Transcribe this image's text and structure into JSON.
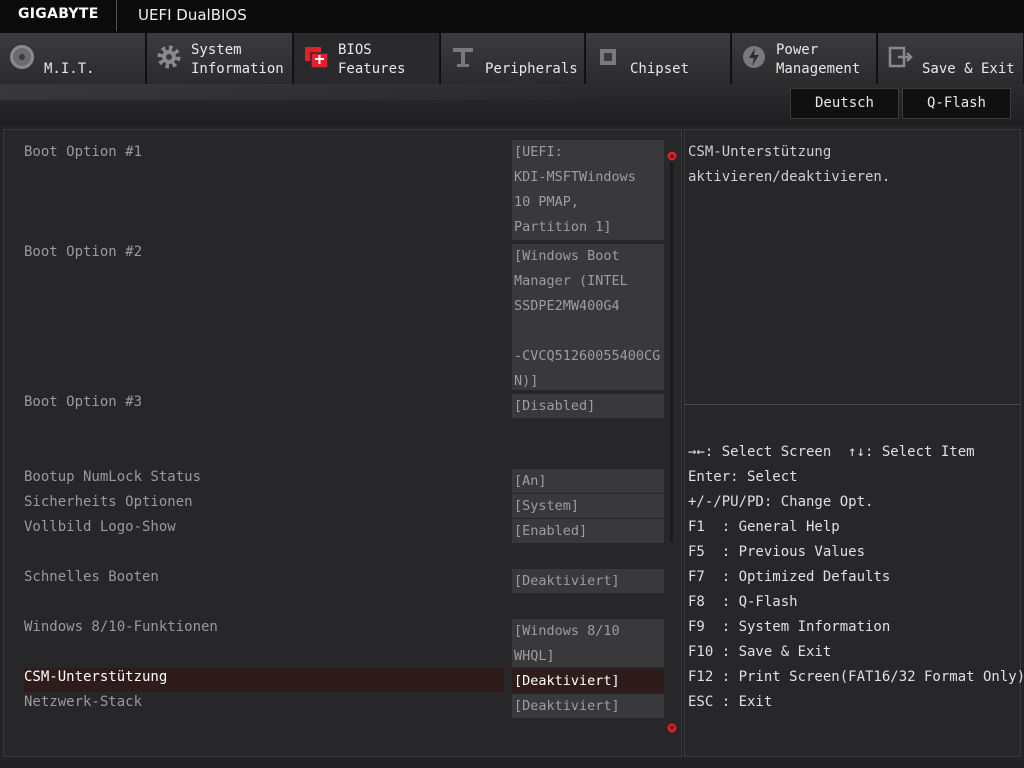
{
  "header": {
    "brand": "GIGABYTE",
    "title": "UEFI DualBIOS"
  },
  "tabs": [
    {
      "line1": "",
      "line2": "M.I.T.",
      "icon": "mit-icon"
    },
    {
      "line1": "System",
      "line2": "Information",
      "icon": "gear-icon"
    },
    {
      "line1": "BIOS",
      "line2": "Features",
      "icon": "bios-chip-icon",
      "active": true
    },
    {
      "line1": "",
      "line2": "Peripherals",
      "icon": "peripherals-icon"
    },
    {
      "line1": "",
      "line2": "Chipset",
      "icon": "chipset-icon"
    },
    {
      "line1": "Power",
      "line2": "Management",
      "icon": "power-icon"
    },
    {
      "line1": "",
      "line2": "Save & Exit",
      "icon": "exit-icon"
    }
  ],
  "toolbar": {
    "language": "Deutsch",
    "qflash": "Q-Flash"
  },
  "options": [
    {
      "label": "Boot Option #1",
      "value": [
        "[UEFI:",
        "KDI-MSFTWindows",
        "10 PMAP,",
        "Partition 1]"
      ]
    },
    {
      "label": "Boot Option #2",
      "value": [
        "[Windows Boot",
        "Manager (INTEL",
        "SSDPE2MW400G4",
        "",
        "-CVCQ51260055400CG",
        "N)]"
      ]
    },
    {
      "label": "Boot Option #3",
      "value": [
        "[Disabled]"
      ]
    },
    {
      "label": "Bootup NumLock Status",
      "value": [
        "[An]"
      ]
    },
    {
      "label": "Sicherheits Optionen",
      "value": [
        "[System]"
      ]
    },
    {
      "label": "Vollbild Logo-Show",
      "value": [
        "[Enabled]"
      ]
    },
    {
      "label": "Schnelles Booten",
      "value": [
        "[Deaktiviert]"
      ]
    },
    {
      "label": "Windows 8/10-Funktionen",
      "value": [
        "[Windows 8/10",
        "WHQL]"
      ]
    },
    {
      "label": "CSM-Unterstützung",
      "value": [
        "[Deaktiviert]"
      ],
      "selected": true
    },
    {
      "label": "Netzwerk-Stack",
      "value": [
        "[Deaktiviert]"
      ]
    }
  ],
  "help": {
    "description": [
      "CSM-Unterstützung",
      "aktivieren/deaktivieren."
    ],
    "keys": [
      "→←: Select Screen  ↑↓: Select Item",
      "Enter: Select",
      "+/-/PU/PD: Change Opt.",
      "F1  : General Help",
      "F5  : Previous Values",
      "F7  : Optimized Defaults",
      "F8  : Q-Flash",
      "F9  : System Information",
      "F10 : Save & Exit",
      "F12 : Print Screen(FAT16/32 Format Only)",
      "ESC : Exit"
    ]
  },
  "colors": {
    "selected_row": "#2e1c1a",
    "active_tab_accent": "#e0202a",
    "scroll_arrow": "#e0202a"
  }
}
